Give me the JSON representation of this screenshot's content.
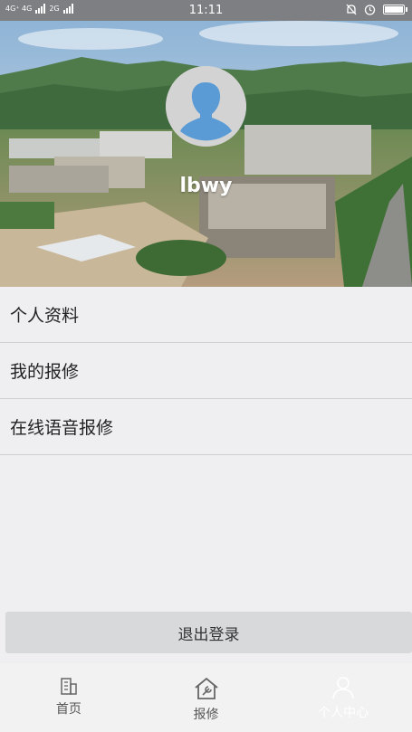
{
  "status_bar": {
    "network_left": "4G⁺ 4G",
    "network_right": "2G",
    "time": "11:11"
  },
  "profile": {
    "username": "lbwy"
  },
  "menu": [
    {
      "label": "个人资料"
    },
    {
      "label": "我的报修"
    },
    {
      "label": "在线语音报修"
    }
  ],
  "logout_label": "退出登录",
  "nav": [
    {
      "label": "首页",
      "icon": "building-icon"
    },
    {
      "label": "报修",
      "icon": "house-wrench-icon"
    },
    {
      "label": "个人中心",
      "icon": "person-icon"
    }
  ]
}
